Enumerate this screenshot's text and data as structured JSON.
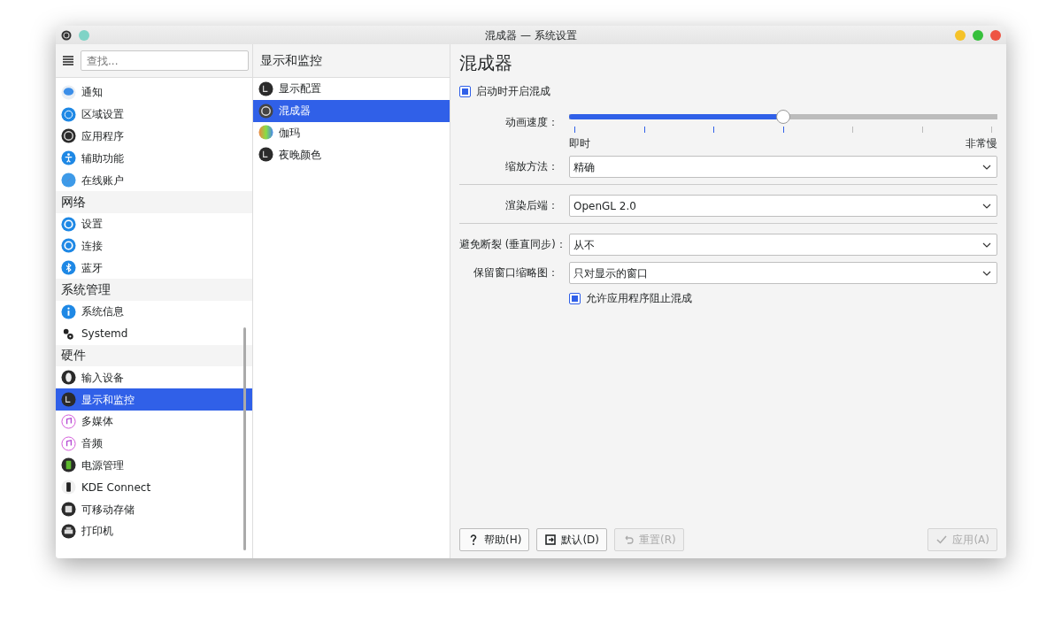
{
  "window": {
    "title": "混成器 — 系统设置"
  },
  "search": {
    "placeholder": "查找..."
  },
  "sidebar": {
    "items": [
      {
        "kind": "item",
        "label": "通知",
        "selected": false
      },
      {
        "kind": "item",
        "label": "区域设置",
        "selected": false
      },
      {
        "kind": "item",
        "label": "应用程序",
        "selected": false
      },
      {
        "kind": "item",
        "label": "辅助功能",
        "selected": false
      },
      {
        "kind": "item",
        "label": "在线账户",
        "selected": false
      },
      {
        "kind": "header",
        "label": "网络"
      },
      {
        "kind": "item",
        "label": "设置",
        "selected": false
      },
      {
        "kind": "item",
        "label": "连接",
        "selected": false
      },
      {
        "kind": "item",
        "label": "蓝牙",
        "selected": false
      },
      {
        "kind": "header",
        "label": "系统管理"
      },
      {
        "kind": "item",
        "label": "系统信息",
        "selected": false
      },
      {
        "kind": "item",
        "label": "Systemd",
        "selected": false
      },
      {
        "kind": "header",
        "label": "硬件"
      },
      {
        "kind": "item",
        "label": "输入设备",
        "selected": false
      },
      {
        "kind": "item",
        "label": "显示和监控",
        "selected": true
      },
      {
        "kind": "item",
        "label": "多媒体",
        "selected": false
      },
      {
        "kind": "item",
        "label": "音频",
        "selected": false
      },
      {
        "kind": "item",
        "label": "电源管理",
        "selected": false
      },
      {
        "kind": "item",
        "label": "KDE Connect",
        "selected": false
      },
      {
        "kind": "item",
        "label": "可移动存储",
        "selected": false
      },
      {
        "kind": "item",
        "label": "打印机",
        "selected": false
      }
    ]
  },
  "subpanel": {
    "title": "显示和监控",
    "items": [
      {
        "label": "显示配置",
        "selected": false
      },
      {
        "label": "混成器",
        "selected": true
      },
      {
        "label": "伽玛",
        "selected": false
      },
      {
        "label": "夜晚颜色",
        "selected": false
      }
    ]
  },
  "page": {
    "title": "混成器",
    "rows": [
      {
        "kind": "checkbox",
        "label": "启动时开启混成",
        "checked": true
      },
      {
        "kind": "slider",
        "label": "动画速度：",
        "level": 0.5,
        "min_label": "即时",
        "max_label": "非常慢"
      },
      {
        "kind": "select",
        "label": "缩放方法：",
        "value": "精确"
      },
      {
        "kind": "divider"
      },
      {
        "kind": "select",
        "label": "渲染后端：",
        "value": "OpenGL 2.0"
      },
      {
        "kind": "divider"
      },
      {
        "kind": "select",
        "label": "避免断裂 (垂直同步)：",
        "value": "从不"
      },
      {
        "kind": "select",
        "label": "保留窗口缩略图：",
        "value": "只对显示的窗口"
      },
      {
        "kind": "field_checkbox",
        "label": "允许应用程序阻止混成",
        "checked": true
      }
    ]
  },
  "buttons": [
    {
      "kind": "help",
      "label": "帮助(H)",
      "disabled": false
    },
    {
      "kind": "defaults",
      "label": "默认(D)",
      "disabled": false
    },
    {
      "kind": "reset",
      "label": "重置(R)",
      "disabled": true
    },
    {
      "kind": "apply",
      "label": "应用(A)",
      "disabled": true
    }
  ]
}
